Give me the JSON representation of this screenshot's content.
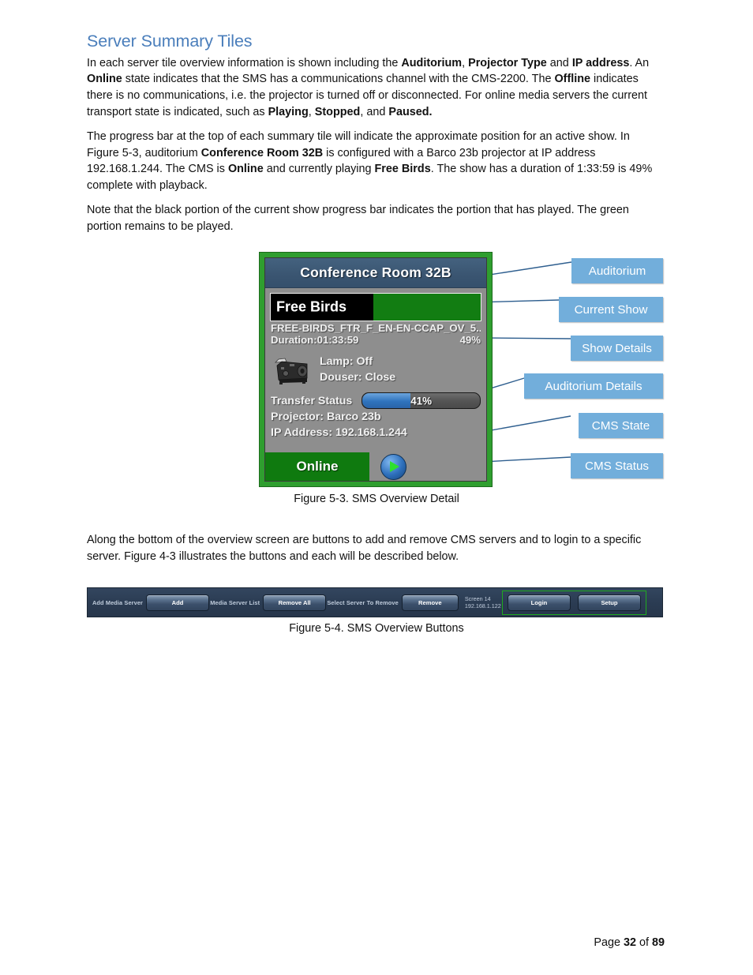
{
  "heading": "Server Summary Tiles",
  "paragraphs": {
    "p1": [
      {
        "t": "In each server tile overview information is shown including the ",
        "b": false
      },
      {
        "t": "Auditorium",
        "b": true
      },
      {
        "t": ", ",
        "b": false
      },
      {
        "t": "Projector Type",
        "b": true
      },
      {
        "t": " and ",
        "b": false
      },
      {
        "t": "IP address",
        "b": true
      },
      {
        "t": ".  An ",
        "b": false
      },
      {
        "t": "Online",
        "b": true
      },
      {
        "t": " state indicates that the SMS has a communications channel with the CMS-2200.  The ",
        "b": false
      },
      {
        "t": "Offline",
        "b": true
      },
      {
        "t": " indicates there is no communications, i.e. the projector is turned off or disconnected.  For online media servers the current transport state is indicated, such as ",
        "b": false
      },
      {
        "t": "Playing",
        "b": true
      },
      {
        "t": ", ",
        "b": false
      },
      {
        "t": "Stopped",
        "b": true
      },
      {
        "t": ", and ",
        "b": false
      },
      {
        "t": "Paused.",
        "b": true
      }
    ],
    "p2": [
      {
        "t": "The progress bar at the top of each summary tile will indicate the approximate position for an active show.  In Figure 5-3, auditorium ",
        "b": false
      },
      {
        "t": "Conference Room 32B",
        "b": true
      },
      {
        "t": " is configured with a Barco 23b projector at IP address 192.168.1.244.  The CMS is ",
        "b": false
      },
      {
        "t": "Online",
        "b": true
      },
      {
        "t": " and currently playing ",
        "b": false
      },
      {
        "t": "Free Birds",
        "b": true
      },
      {
        "t": ".  The show has a duration of 1:33:59 is 49% complete with playback.",
        "b": false
      }
    ],
    "p3": [
      {
        "t": "Note that the black portion of the current show progress bar indicates the portion that has played.  The green portion remains to be played.",
        "b": false
      }
    ],
    "p4": [
      {
        "t": "Along the bottom of the overview screen are buttons to add and remove CMS servers and to login to a specific server.  Figure 4-3 illustrates the buttons and each will be described below.",
        "b": false
      }
    ]
  },
  "figure53": {
    "caption": "Figure 5-3.  SMS Overview Detail",
    "tile": {
      "auditorium": "Conference Room 32B",
      "current_show": "Free Birds",
      "progress_percent": 49,
      "show_file": "FREE-BIRDS_FTR_F_EN-EN-CCAP_OV_5...",
      "duration_label": "Duration:01:33:59",
      "percent_label": "49%",
      "lamp": "Lamp: Off",
      "douser": "Douser: Close",
      "transfer_status_label": "Transfer Status",
      "transfer_percent": 41,
      "transfer_percent_label": "41%",
      "projector": "Projector: Barco 23b",
      "ip_address": "IP Address: 192.168.1.244",
      "cms_state": "Online",
      "cms_status_icon": "play-icon",
      "colors": {
        "tile_border_green": "#2f9e2f",
        "tile_body_gray": "#8e8e8e",
        "header_blue": "#3a5571",
        "show_remaining_green": "#127d12",
        "show_played_black": "#000000",
        "transfer_fill_blue": "#2f73bd",
        "online_green": "#0f7a0f"
      }
    },
    "callouts": [
      {
        "label": "Auditorium"
      },
      {
        "label": "Current Show"
      },
      {
        "label": "Show Details"
      },
      {
        "label": "Auditorium Details"
      },
      {
        "label": "CMS State"
      },
      {
        "label": "CMS Status"
      }
    ],
    "callout_color": "#72aedb"
  },
  "figure54": {
    "caption": "Figure 5-4.  SMS Overview Buttons",
    "bar": {
      "add_media_server_label": "Add Media Server",
      "add_button": "Add",
      "media_server_list_label": "Media Server List",
      "remove_all_button": "Remove All",
      "select_server_label": "Select Server To Remove",
      "remove_button": "Remove",
      "screen_name": "Screen 14",
      "screen_ip": "192.168.1.122",
      "login_button": "Login",
      "setup_button": "Setup",
      "highlight_color": "#1faa1f",
      "bar_color": "#2b3c53"
    }
  },
  "footer": {
    "prefix": "Page ",
    "page": "32",
    "middle": " of ",
    "total": "89"
  }
}
